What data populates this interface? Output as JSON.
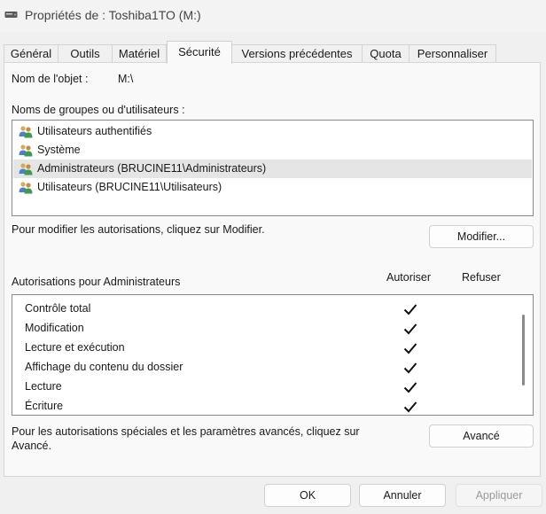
{
  "window": {
    "title": "Propriétés de : Toshiba1TO (M:)",
    "title_icon": "drive-icon"
  },
  "tabs": [
    {
      "label": "Général",
      "active": false
    },
    {
      "label": "Outils",
      "active": false
    },
    {
      "label": "Matériel",
      "active": false
    },
    {
      "label": "Sécurité",
      "active": true
    },
    {
      "label": "Versions précédentes",
      "active": false
    },
    {
      "label": "Quota",
      "active": false
    },
    {
      "label": "Personnaliser",
      "active": false
    }
  ],
  "object": {
    "label": "Nom de l'objet :",
    "value": "M:\\"
  },
  "groups": {
    "label": "Noms de groupes ou d'utilisateurs :",
    "items": [
      {
        "name": "Utilisateurs authentifiés",
        "selected": false
      },
      {
        "name": "Système",
        "selected": false
      },
      {
        "name": "Administrateurs (BRUCINE11\\Administrateurs)",
        "selected": true
      },
      {
        "name": "Utilisateurs (BRUCINE11\\Utilisateurs)",
        "selected": false
      }
    ],
    "icon": "users-icon"
  },
  "modify": {
    "hint": "Pour modifier les autorisations, cliquez sur Modifier.",
    "button": "Modifier..."
  },
  "permissions": {
    "label": "Autorisations pour Administrateurs",
    "allow_header": "Autoriser",
    "deny_header": "Refuser",
    "rows": [
      {
        "name": "Contrôle total",
        "allow": true,
        "deny": false
      },
      {
        "name": "Modification",
        "allow": true,
        "deny": false
      },
      {
        "name": "Lecture et exécution",
        "allow": true,
        "deny": false
      },
      {
        "name": "Affichage du contenu du dossier",
        "allow": true,
        "deny": false
      },
      {
        "name": "Lecture",
        "allow": true,
        "deny": false
      },
      {
        "name": "Écriture",
        "allow": true,
        "deny": false
      }
    ],
    "check_icon": "checkmark-icon"
  },
  "advanced": {
    "hint_line1": "Pour les autorisations spéciales et les paramètres avancés, cliquez sur",
    "hint_line2": "Avancé.",
    "button": "Avancé"
  },
  "footer": {
    "ok": "OK",
    "cancel": "Annuler",
    "apply": "Appliquer",
    "apply_enabled": false
  }
}
